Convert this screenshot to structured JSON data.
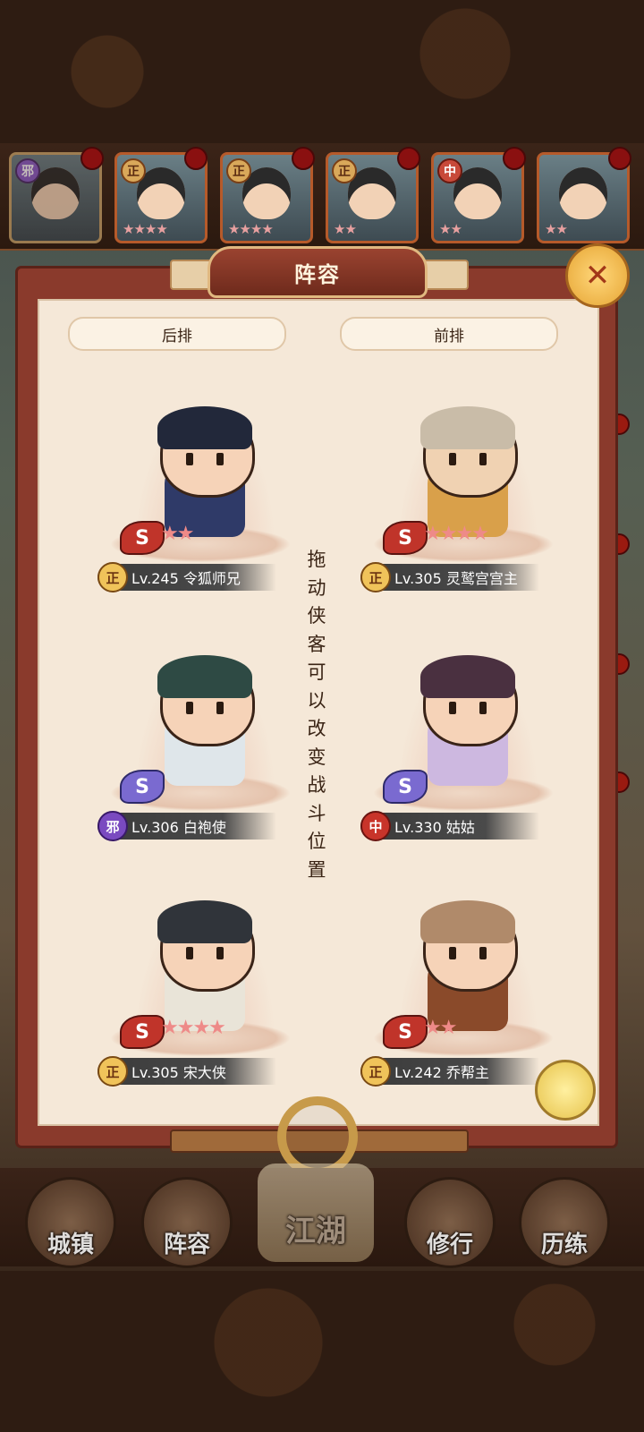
{
  "hero_strip": [
    {
      "faction": "邪",
      "stars": "",
      "faction_type": "evil"
    },
    {
      "faction": "正",
      "stars": "★★★★",
      "faction_type": "good"
    },
    {
      "faction": "正",
      "stars": "★★★★",
      "faction_type": "good"
    },
    {
      "faction": "正",
      "stars": "★★",
      "faction_type": "good"
    },
    {
      "faction": "中",
      "stars": "★★",
      "faction_type": "mid"
    },
    {
      "faction": "",
      "stars": "★★",
      "faction_type": "good"
    }
  ],
  "panel": {
    "title": "阵容",
    "close_icon": "close-x-icon",
    "back_row_label": "后排",
    "front_row_label": "前排",
    "hint": "拖动侠客可以改变战斗位置"
  },
  "heroes": {
    "back": [
      {
        "faction": "正",
        "level_name": "Lv.245 令狐师兄",
        "stars": "★★",
        "tier": "S"
      },
      {
        "faction": "邪",
        "level_name": "Lv.306 白袍使",
        "stars": "",
        "tier": "S"
      },
      {
        "faction": "正",
        "level_name": "Lv.305 宋大侠",
        "stars": "★★★★",
        "tier": "S"
      }
    ],
    "front": [
      {
        "faction": "正",
        "level_name": "Lv.305 灵鹫宫宫主",
        "stars": "★★★★",
        "tier": "S"
      },
      {
        "faction": "中",
        "level_name": "Lv.330 姑姑",
        "stars": "",
        "tier": "S"
      },
      {
        "faction": "正",
        "level_name": "Lv.242 乔帮主",
        "stars": "★★",
        "tier": "S"
      }
    ]
  },
  "nav": {
    "town": "城镇",
    "lineup": "阵容",
    "jianghu": "江湖",
    "practice": "修行",
    "trial": "历练"
  },
  "colors": {
    "panel_bg": "#f5e8d8",
    "frame": "#8a3a2c",
    "title_plate": "#9a4330",
    "star": "#ee8a88"
  }
}
